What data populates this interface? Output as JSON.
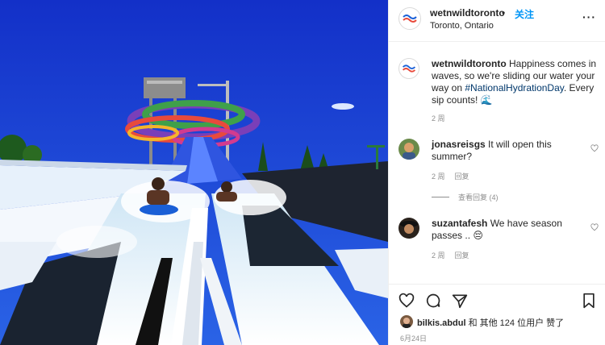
{
  "post": {
    "username": "wetnwildtoronto",
    "dot": "•",
    "follow_label": "关注",
    "location": "Toronto, Ontario",
    "more_label": "···"
  },
  "caption": {
    "username": "wetnwildtoronto",
    "text_before": " Happiness comes in waves, so we're sliding our water your way on ",
    "hashtag": "#NationalHydrationDay",
    "text_after": ". Every sip counts! 🌊",
    "time": "2 周"
  },
  "comments": [
    {
      "username": "jonasreisgs",
      "text": " It will open this summer?",
      "time": "2 周",
      "reply_label": "回复"
    },
    {
      "username": "suzantafesh",
      "text": " We have season passes .. 😔",
      "time": "2 周",
      "reply_label": "回复"
    }
  ],
  "view_replies_label": "查看回复 (4)",
  "likes": {
    "username": "bilkis.abdul",
    "rest": " 和 其他 124 位用户 赞了"
  },
  "date": "6月24日",
  "icons": [
    "heart-icon",
    "comment-icon",
    "share-icon",
    "bookmark-icon",
    "more-icon"
  ],
  "colors": {
    "link": "#0095f6",
    "hashtag": "#00376b",
    "meta": "#8e8e8e"
  }
}
